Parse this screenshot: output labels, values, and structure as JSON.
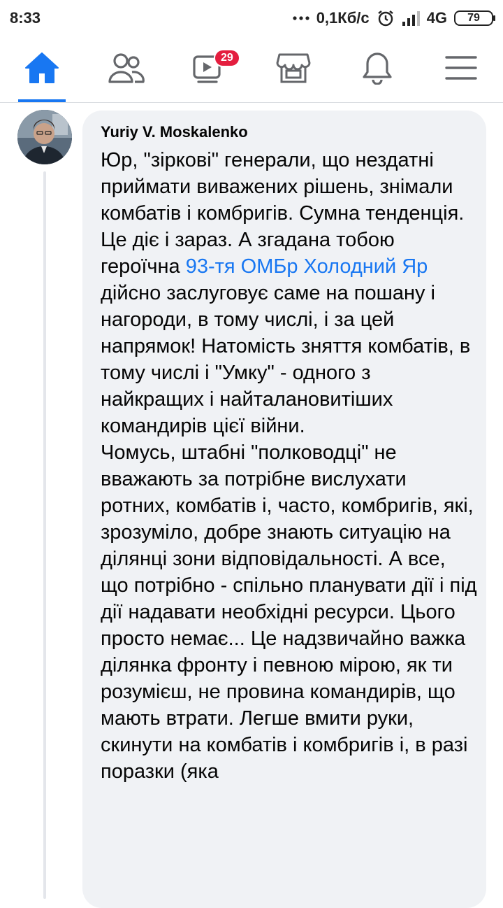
{
  "status_bar": {
    "time": "8:33",
    "network_speed": "0,1Кб/с",
    "network_type": "4G",
    "battery": "79",
    "icons": [
      "more-dots-icon",
      "alarm-icon",
      "signal-icon"
    ]
  },
  "nav": {
    "tabs": [
      {
        "name": "home",
        "icon": "home-icon",
        "active": true
      },
      {
        "name": "friends",
        "icon": "friends-icon",
        "active": false
      },
      {
        "name": "watch",
        "icon": "video-icon",
        "active": false,
        "badge": "29"
      },
      {
        "name": "marketplace",
        "icon": "marketplace-icon",
        "active": false
      },
      {
        "name": "notifications",
        "icon": "bell-icon",
        "active": false
      },
      {
        "name": "menu",
        "icon": "menu-icon",
        "active": false
      }
    ],
    "accent_color": "#1877f2"
  },
  "comment": {
    "author": "Yuriy V. Moskalenko",
    "p1_before_mention": "Юр, \"зіркові\" генерали, що нездатні приймати виважених рішень, знімали комбатів і комбригів. Сумна тенденція. Це діє і зараз. А згадана тобою героїчна ",
    "mention": "93-тя ОМБр Холодний Яр",
    "p1_after_mention": " дійсно заслуговує саме на пошану і нагороди, в тому числі, і за цей напрямок! Натомість зняття комбатів, в тому числі і \"Умку\" - одного з найкращих і найталановитіших командирів цієї війни.",
    "p2": "Чомусь, штабні \"полководці\" не вважають за потрібне вислухати ротних, комбатів і, часто, комбригів, які, зрозуміло, добре знають ситуацію на ділянці зони відповідальності. А все, що потрібно - спільно планувати дії і під дії надавати необхідні ресурси. Цього просто немає... Це надзвичайно важка ділянка фронту і певною мірою, як ти розумієш, не провина командирів, що мають втрати. Легше вмити руки, скинути на комбатів і комбригів і, в разі поразки (яка"
  }
}
